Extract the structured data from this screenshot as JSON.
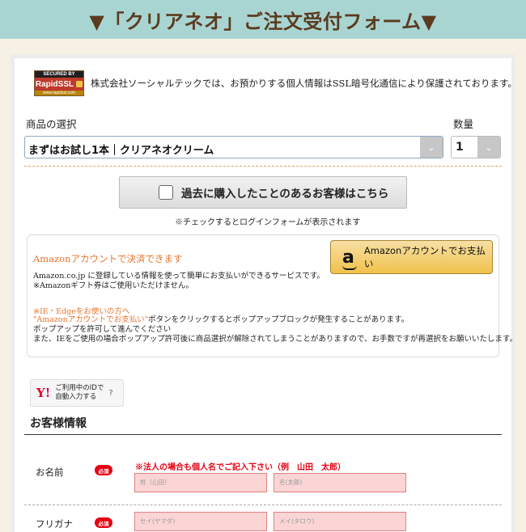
{
  "banner": {
    "title": "▼「クリアネオ」ご注文受付フォーム▼"
  },
  "ssl": {
    "badge_top": "SECURED BY",
    "badge_brand": "RapidSSL",
    "badge_url": "www.rapidssl.com",
    "notice": "株式会社ソーシャルテックでは、お預かりする個人情報はSSL暗号化通信により保護されております。"
  },
  "product": {
    "label": "商品の選択",
    "selected": "まずはお試し1本｜クリアネオクリーム",
    "quantity_label": "数量",
    "quantity_value": "1"
  },
  "past_customer": {
    "label": "過去に購入したことのあるお客様はこちら",
    "note": "※チェックするとログインフォームが表示されます"
  },
  "amazon": {
    "heading": "Amazonアカウントで決済できます",
    "button_label": "Amazonアカウントでお支払い",
    "logo": "a",
    "desc_1": "Amazon.co.jp に登録している情報を使って簡単にお支払いができるサービスです。",
    "desc_2": "※Amazonギフト券はご使用いただけません。",
    "ie_heading": "※IE・Edgeをお使いの方へ",
    "ie_line_1_orange": "\"Amazonアカウントでお支払い\"",
    "ie_line_1_rest": "ボタンをクリックするとポップアップブロックが発生することがあります。",
    "ie_line_2": "ポップアップを許可して進んでください",
    "ie_line_3": "また、IEをご使用の場合ポップアップ許可後に商品選択が解除されてしまうことがありますので、お手数ですが再選択をお願いいたします。"
  },
  "yahoo": {
    "logo": "Y!",
    "line_1": "ご利用中のIDで",
    "line_2": "自動入力する",
    "help": "?"
  },
  "customer": {
    "section_title": "お客様情報",
    "name_label": "お名前",
    "required_badge": "必須",
    "name_note": "※法人の場合も個人名でご記入下さい（例　山田　太郎）",
    "last_name_placeholder": "姓（山田）",
    "first_name_placeholder": "名(太郎)",
    "furigana_label": "フリガナ",
    "last_kana_placeholder": "セイ(ヤマダ)",
    "first_kana_placeholder": "メイ(タロウ)"
  },
  "colors": {
    "banner_bg": "#a8d5d2",
    "banner_text": "#5b3a1e",
    "accent_orange": "#e8742b",
    "required_red": "#e60012",
    "field_bg": "#fbd5d5",
    "amazon_button": "#f0c14b"
  }
}
